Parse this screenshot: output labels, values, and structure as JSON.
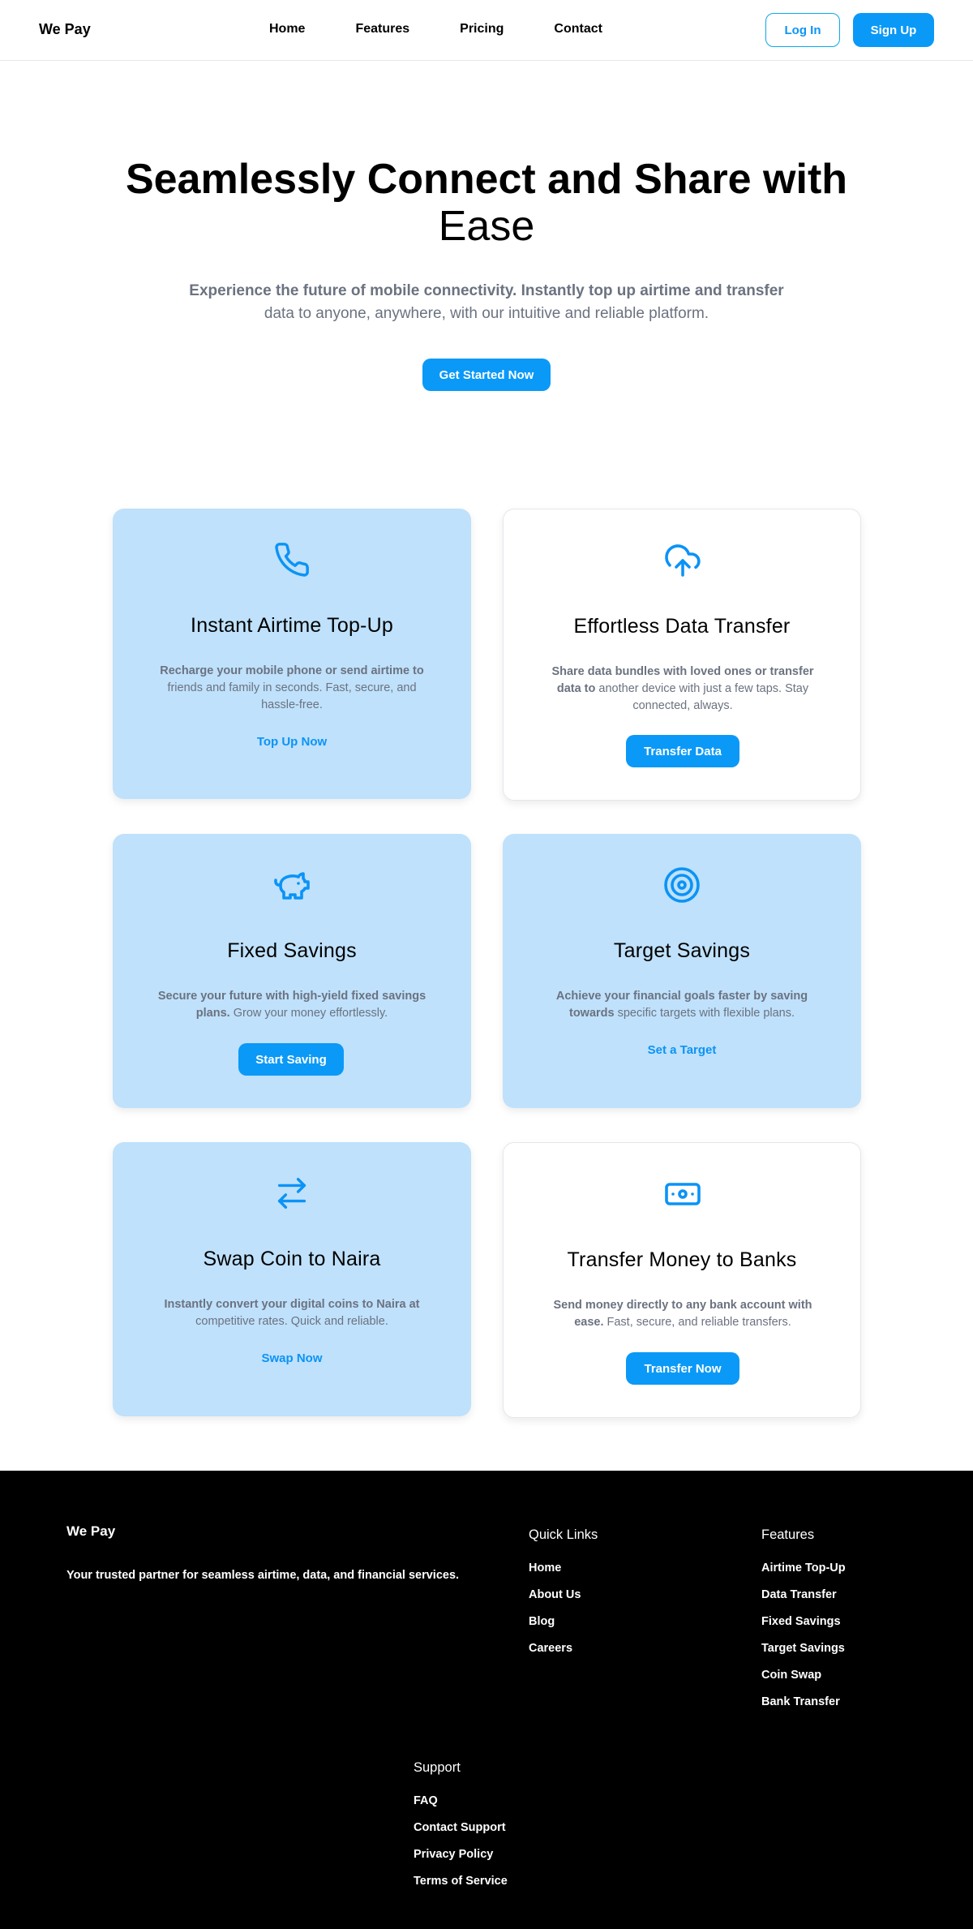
{
  "nav": {
    "brand": "We Pay",
    "links": [
      "Home",
      "Features",
      "Pricing",
      "Contact"
    ],
    "login": "Log In",
    "signup": "Sign Up"
  },
  "hero": {
    "title_line1": "Seamlessly Connect and Share with",
    "title_line2": "Ease",
    "subtitle_bold": "Experience the future of mobile connectivity. Instantly top up airtime and transfer",
    "subtitle_rest": "data to anyone, anywhere, with our intuitive and reliable platform.",
    "cta": "Get Started Now"
  },
  "colors": {
    "accent": "#0b99f7",
    "card_blue": "#bfe1fb",
    "text_muted": "#6b7280",
    "footer_bg": "#000000"
  },
  "cards": [
    {
      "icon": "phone-icon",
      "title": "Instant Airtime Top-Up",
      "desc_bold": "Recharge your mobile phone or send airtime to",
      "desc_rest": "friends and family in seconds. Fast, secure, and hassle-free.",
      "action": "Top Up Now"
    },
    {
      "icon": "cloud-upload-icon",
      "title": "Effortless Data Transfer",
      "desc_bold": "Share data bundles with loved ones or transfer data to",
      "desc_rest": "another device with just a few taps. Stay connected, always.",
      "action": "Transfer Data"
    },
    {
      "icon": "piggy-bank-icon",
      "title": "Fixed Savings",
      "desc_bold": "Secure your future with high-yield fixed savings plans.",
      "desc_rest": "Grow your money effortlessly.",
      "action": "Start Saving"
    },
    {
      "icon": "target-icon",
      "title": "Target Savings",
      "desc_bold": "Achieve your financial goals faster by saving towards",
      "desc_rest": "specific targets with flexible plans.",
      "action": "Set a Target"
    },
    {
      "icon": "swap-arrows-icon",
      "title": "Swap Coin to Naira",
      "desc_bold": "Instantly convert your digital coins to Naira at",
      "desc_rest": "competitive rates. Quick and reliable.",
      "action": "Swap Now"
    },
    {
      "icon": "banknote-icon",
      "title": "Transfer Money to Banks",
      "desc_bold": "Send money directly to any bank account with ease.",
      "desc_rest": "Fast, secure, and reliable transfers.",
      "action": "Transfer Now"
    }
  ],
  "footer": {
    "brand": "We Pay",
    "tagline": "Your trusted partner for seamless airtime, data, and financial services.",
    "quick_links": {
      "heading": "Quick Links",
      "items": [
        "Home",
        "About Us",
        "Blog",
        "Careers"
      ]
    },
    "features": {
      "heading": "Features",
      "items": [
        "Airtime Top-Up",
        "Data Transfer",
        "Fixed Savings",
        "Target Savings",
        "Coin Swap",
        "Bank Transfer"
      ]
    },
    "support": {
      "heading": "Support",
      "items": [
        "FAQ",
        "Contact Support",
        "Privacy Policy",
        "Terms of Service"
      ]
    }
  }
}
